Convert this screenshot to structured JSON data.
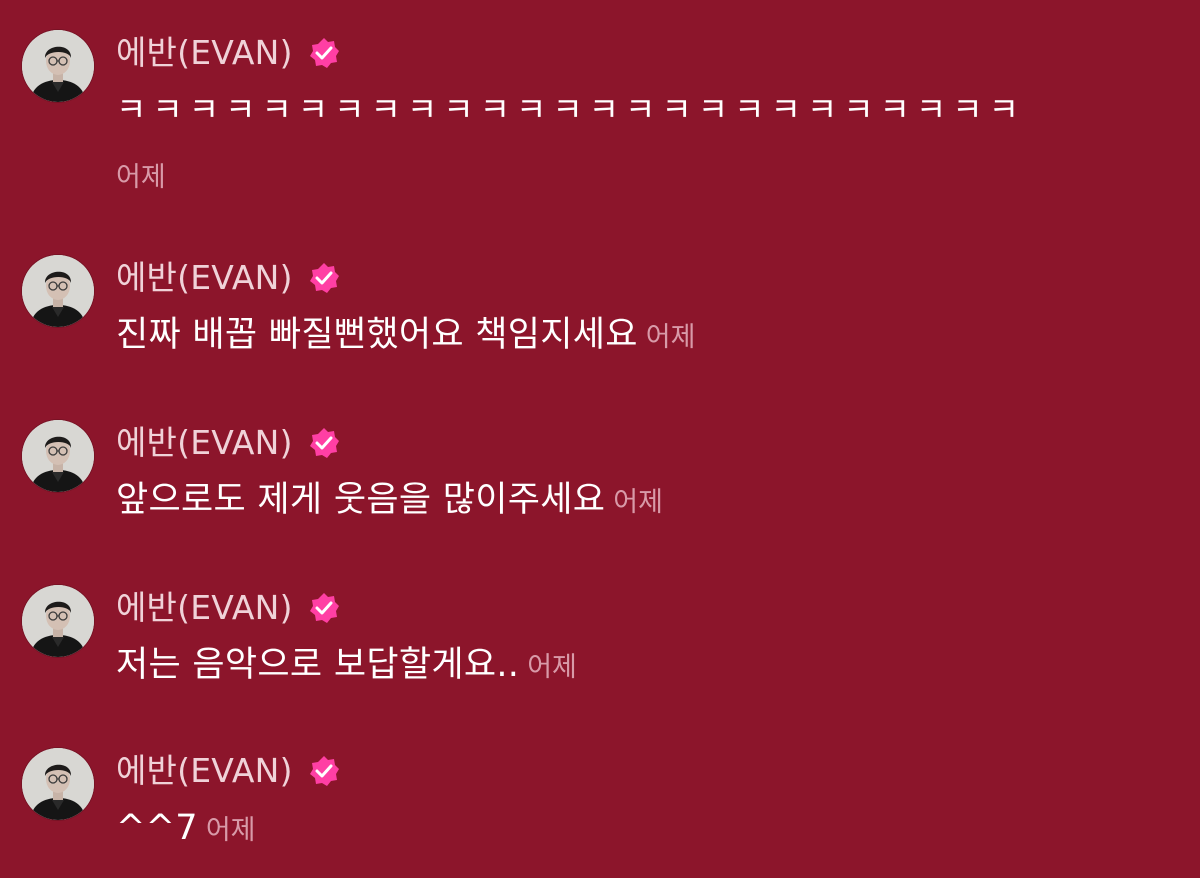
{
  "messages": [
    {
      "sender": "에반(EVAN)",
      "text": "ㅋㅋㅋㅋㅋㅋㅋㅋㅋㅋㅋㅋㅋㅋㅋㅋㅋㅋㅋㅋㅋㅋㅋㅋㅋ",
      "time": "어제"
    },
    {
      "sender": "에반(EVAN)",
      "text": "진짜 배꼽 빠질뻔했어요 책임지세요",
      "time": "어제"
    },
    {
      "sender": "에반(EVAN)",
      "text": "앞으로도 제게 웃음을 많이주세요",
      "time": "어제"
    },
    {
      "sender": "에반(EVAN)",
      "text": "저는 음악으로 보답할게요..",
      "time": "어제"
    },
    {
      "sender": "에반(EVAN)",
      "text": "^^7",
      "time": "어제"
    }
  ],
  "colors": {
    "background": "#8c152b",
    "verified_badge": "#ff3fa4",
    "timestamp": "#d89aa8"
  },
  "icons": {
    "avatar": "profile-photo",
    "verified": "verified-badge-icon"
  }
}
